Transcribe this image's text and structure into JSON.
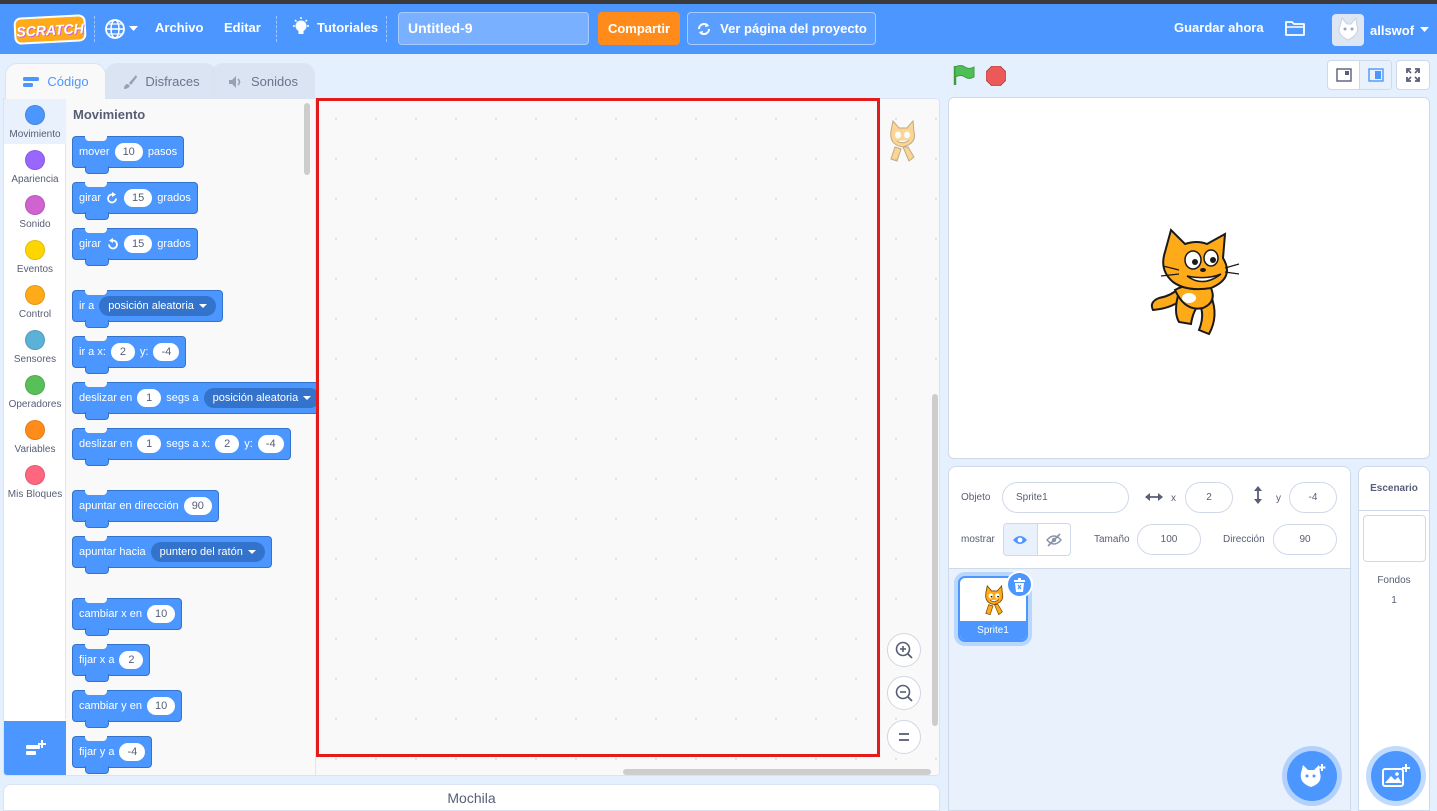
{
  "menubar": {
    "logo": "SCRATCH",
    "file": "Archivo",
    "edit": "Editar",
    "tutorials": "Tutoriales",
    "project_title": "Untitled-9",
    "share": "Compartir",
    "see_project_page": "Ver página del proyecto",
    "save_now": "Guardar ahora",
    "username": "allswof"
  },
  "tabs": {
    "code": "Código",
    "costumes": "Disfraces",
    "sounds": "Sonidos"
  },
  "categories": [
    {
      "label": "Movimiento",
      "color": "#4c97ff"
    },
    {
      "label": "Apariencia",
      "color": "#9966ff"
    },
    {
      "label": "Sonido",
      "color": "#cf63cf"
    },
    {
      "label": "Eventos",
      "color": "#ffd500"
    },
    {
      "label": "Control",
      "color": "#ffab19"
    },
    {
      "label": "Sensores",
      "color": "#5cb1d6"
    },
    {
      "label": "Operadores",
      "color": "#59c059"
    },
    {
      "label": "Variables",
      "color": "#ff8c1a"
    },
    {
      "label": "Mis Bloques",
      "color": "#ff6680"
    }
  ],
  "flyout": {
    "title": "Movimiento",
    "blocks": {
      "move": {
        "a": "mover",
        "v": "10",
        "b": "pasos"
      },
      "turn_right": {
        "a": "girar",
        "v": "15",
        "b": "grados"
      },
      "turn_left": {
        "a": "girar",
        "v": "15",
        "b": "grados"
      },
      "goto": {
        "a": "ir a",
        "menu": "posición aleatoria"
      },
      "goto_xy": {
        "a": "ir a x:",
        "x": "2",
        "b": "y:",
        "y": "-4"
      },
      "glide_to": {
        "a": "deslizar en",
        "v": "1",
        "b": "segs a",
        "menu": "posición aleatoria"
      },
      "glide_xy": {
        "a": "deslizar en",
        "v": "1",
        "b": "segs a x:",
        "x": "2",
        "c": "y:",
        "y": "-4"
      },
      "point_dir": {
        "a": "apuntar en dirección",
        "v": "90"
      },
      "point_towards": {
        "a": "apuntar hacia",
        "menu": "puntero del ratón"
      },
      "change_x": {
        "a": "cambiar x en",
        "v": "10"
      },
      "set_x": {
        "a": "fijar x a",
        "v": "2"
      },
      "change_y": {
        "a": "cambiar y en",
        "v": "10"
      },
      "set_y": {
        "a": "fijar y a",
        "v": "-4"
      }
    }
  },
  "workspace": {
    "backpack": "Mochila"
  },
  "sprite_info": {
    "sprite_label": "Objeto",
    "sprite_name": "Sprite1",
    "x_label": "x",
    "x_value": "2",
    "y_label": "y",
    "y_value": "-4",
    "show_label": "mostrar",
    "size_label": "Tamaño",
    "size_value": "100",
    "direction_label": "Dirección",
    "direction_value": "90"
  },
  "sprite_list": [
    {
      "name": "Sprite1"
    }
  ],
  "stage_selector": {
    "title": "Escenario",
    "backdrops_label": "Fondos",
    "backdrops_count": "1"
  },
  "colors": {
    "primary": "#4c97ff",
    "share": "#ff8c1a",
    "highlight": "#e31b1b",
    "menubar": "#4c97ff"
  }
}
